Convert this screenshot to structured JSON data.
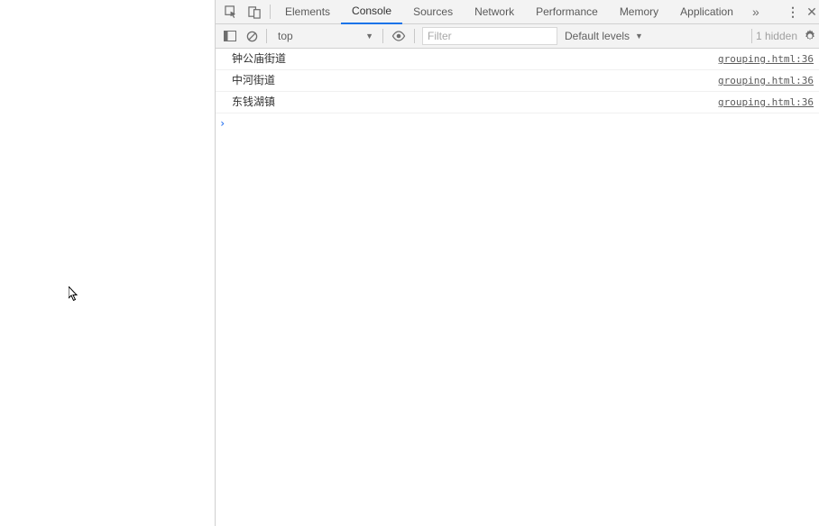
{
  "tabs": {
    "elements": "Elements",
    "console": "Console",
    "sources": "Sources",
    "network": "Network",
    "performance": "Performance",
    "memory": "Memory",
    "application": "Application"
  },
  "toolbar": {
    "context": "top",
    "filter_placeholder": "Filter",
    "levels": "Default levels",
    "hidden": "1 hidden"
  },
  "logs": [
    {
      "msg": "钟公庙街道",
      "src": "grouping.html:36"
    },
    {
      "msg": "中河街道",
      "src": "grouping.html:36"
    },
    {
      "msg": "东钱湖镇",
      "src": "grouping.html:36"
    }
  ]
}
